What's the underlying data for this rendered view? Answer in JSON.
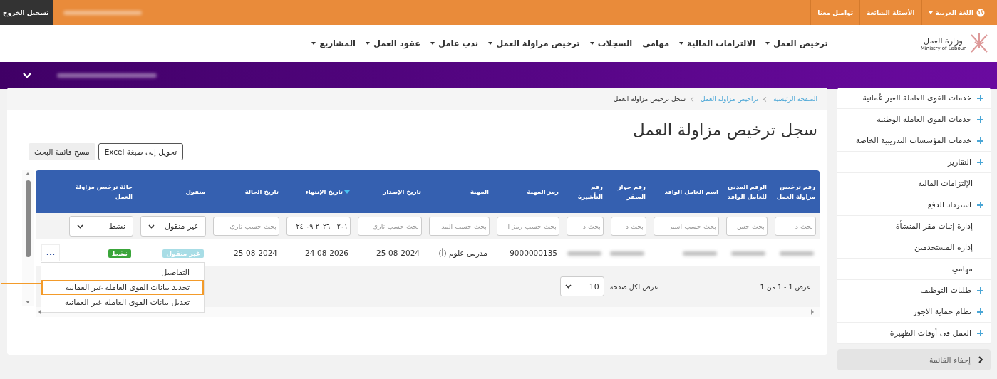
{
  "top_bar": {
    "language": "اللغة العربية",
    "links": [
      "الأسئلة الشائعة",
      "تواصل معنا"
    ],
    "logout": "تسجيل الخروج"
  },
  "logo": {
    "arabic": "وزارة العمل",
    "english": "Ministry of Labour"
  },
  "nav": [
    {
      "label": "ترخيص العمل",
      "dropdown": true
    },
    {
      "label": "الالتزامات المالية",
      "dropdown": true
    },
    {
      "label": "مهامي",
      "dropdown": false
    },
    {
      "label": "السجلات",
      "dropdown": true
    },
    {
      "label": "ترخيص مزاولة العمل",
      "dropdown": true
    },
    {
      "label": "ندب عامل",
      "dropdown": true
    },
    {
      "label": "عقود العمل",
      "dropdown": true
    },
    {
      "label": "المشاريع",
      "dropdown": true
    }
  ],
  "breadcrumb": [
    {
      "label": "الصفحة الرئيسية",
      "link": true
    },
    {
      "label": "تراخيص مزاولة العمل",
      "link": true
    },
    {
      "label": "سجل ترخيص مزاولة العمل",
      "link": false
    }
  ],
  "page_title": "سجل ترخيص مزاولة العمل",
  "buttons": [
    {
      "label": "تحويل إلى صيغة Excel",
      "kind": "outline"
    },
    {
      "label": "مسح قائمة البحث",
      "kind": "plain"
    }
  ],
  "table": {
    "columns": [
      {
        "label": "رقم ترخيص مزاولة العمل",
        "sorted": false
      },
      {
        "label": "الرقم المدني للعامل الوافد",
        "sorted": false
      },
      {
        "label": "اسم العامل الوافد",
        "sorted": false
      },
      {
        "label": "رقم جواز السفر",
        "sorted": false
      },
      {
        "label": "رقم التأشيرة",
        "sorted": false
      },
      {
        "label": "رمز المهنة",
        "sorted": false
      },
      {
        "label": "المهنة",
        "sorted": false
      },
      {
        "label": "تاريخ الإصدار",
        "sorted": false
      },
      {
        "label": "تاريخ الإنتهاء",
        "sorted": true
      },
      {
        "label": "تاريخ الحالة",
        "sorted": false
      },
      {
        "label": "منقول",
        "sorted": false
      },
      {
        "label": "حالة ترخيص مزاولة العمل",
        "sorted": false
      }
    ],
    "filters": [
      {
        "kind": "input",
        "placeholder": "بحث د"
      },
      {
        "kind": "input",
        "placeholder": "بحث حس"
      },
      {
        "kind": "input",
        "placeholder": "بحث حسب اسم"
      },
      {
        "kind": "input",
        "placeholder": "بحث د"
      },
      {
        "kind": "input",
        "placeholder": "بحث د"
      },
      {
        "kind": "input",
        "placeholder": "بحث حسب رمز ا"
      },
      {
        "kind": "input",
        "placeholder": "بحث حسب المد"
      },
      {
        "kind": "input",
        "placeholder": "بحث حسب تاري"
      },
      {
        "kind": "input",
        "value": "٢٠١ - ٢٠٢٦-٠٩-٢٤"
      },
      {
        "kind": "input",
        "placeholder": "بحث حسب تاري"
      },
      {
        "kind": "select",
        "value": "غير منقول"
      },
      {
        "kind": "select",
        "value": "نشط"
      }
    ],
    "rows": [
      {
        "cells": [
          {
            "kind": "redacted"
          },
          {
            "kind": "redacted"
          },
          {
            "kind": "redacted"
          },
          {
            "kind": "redacted"
          },
          {
            "kind": "redacted"
          },
          {
            "kind": "text",
            "text": "9000000135"
          },
          {
            "kind": "text",
            "text": "مدرس علوم (أ)"
          },
          {
            "kind": "text",
            "text": "25-08-2024"
          },
          {
            "kind": "text",
            "text": "24-08-2026"
          },
          {
            "kind": "text",
            "text": "25-08-2024"
          },
          {
            "kind": "badge",
            "text": "غير منقول",
            "color": "#a8dde6"
          },
          {
            "kind": "badge",
            "text": "نشط",
            "color": "#3aa53a"
          }
        ],
        "actions": "...",
        "menu": [
          {
            "label": "التفاصيل",
            "highlighted": false
          },
          {
            "label": "تجديد بيانات القوى العاملة غير العمانية",
            "highlighted": true
          },
          {
            "label": "تعديل بيانات القوى العاملة غير العمانية",
            "highlighted": false
          }
        ]
      }
    ],
    "pagination": {
      "summary": "عرض 1 - 1 من 1",
      "per_page_label": "عرض لكل صفحة",
      "per_page": "10"
    }
  },
  "sidebar": [
    {
      "label": "خدمات القوى العاملة الغير عُمانية",
      "expandable": true
    },
    {
      "label": "خدمات القوى العاملة الوطنية",
      "expandable": true
    },
    {
      "label": "خدمات المؤسسات التدريبية الخاصة",
      "expandable": true
    },
    {
      "label": "التقارير",
      "expandable": true
    },
    {
      "label": "الإلتزامات المالية",
      "expandable": false
    },
    {
      "label": "استرداد الدفع",
      "expandable": true
    },
    {
      "label": "إدارة إثبات مقر المنشأة",
      "expandable": false
    },
    {
      "label": "إدارة المستخدمين",
      "expandable": false
    },
    {
      "label": "مهامي",
      "expandable": false
    },
    {
      "label": "طلبات التوظيف",
      "expandable": true
    },
    {
      "label": "نظام حماية الاجور",
      "expandable": true
    },
    {
      "label": "العمل فى أوقات الظهيرة",
      "expandable": true
    }
  ],
  "hide_menu": "إخفاء القائمة"
}
